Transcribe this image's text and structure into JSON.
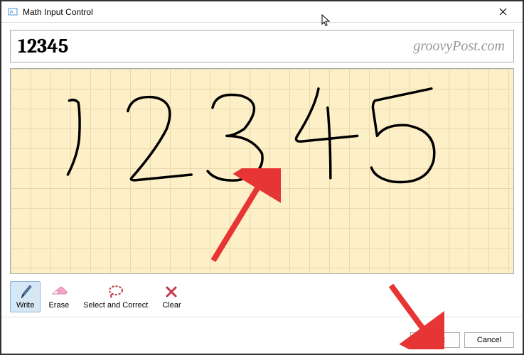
{
  "window": {
    "title": "Math Input Control",
    "close_label": "✕"
  },
  "preview": {
    "value": "12345"
  },
  "watermark": "groovyPost.com",
  "tools": {
    "write": "Write",
    "erase": "Erase",
    "select_correct": "Select and Correct",
    "clear": "Clear"
  },
  "buttons": {
    "insert": "Insert",
    "cancel": "Cancel"
  }
}
